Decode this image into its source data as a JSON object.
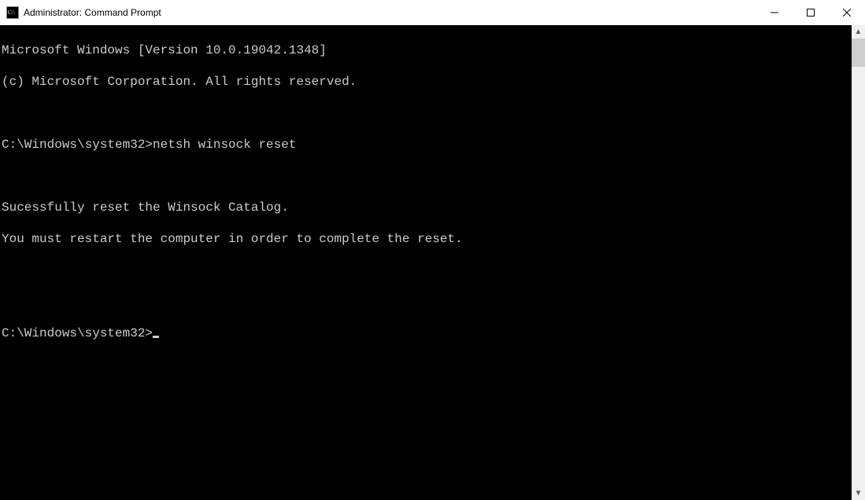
{
  "titlebar": {
    "title": "Administrator: Command Prompt"
  },
  "console": {
    "lines": [
      "Microsoft Windows [Version 10.0.19042.1348]",
      "(c) Microsoft Corporation. All rights reserved.",
      "",
      "C:\\Windows\\system32>netsh winsock reset",
      "",
      "Sucessfully reset the Winsock Catalog.",
      "You must restart the computer in order to complete the reset.",
      "",
      "",
      "C:\\Windows\\system32>"
    ]
  },
  "icons": {
    "minimize": "minimize",
    "maximize": "maximize",
    "close": "close",
    "scroll_up": "▲",
    "scroll_down": "▼"
  }
}
